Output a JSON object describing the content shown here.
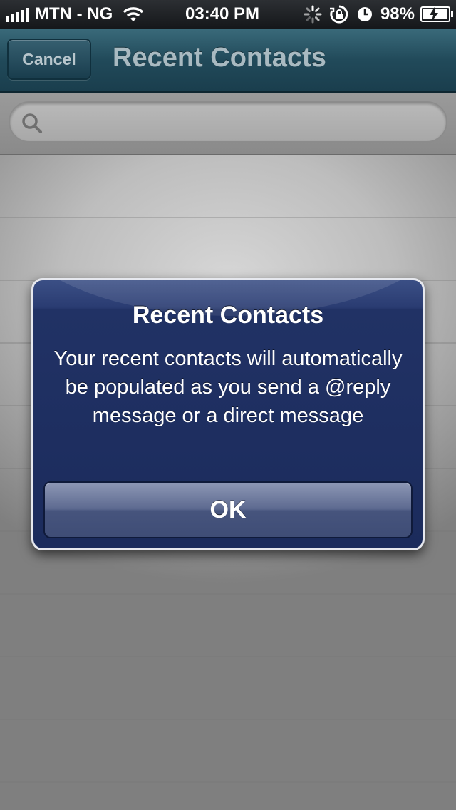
{
  "status_bar": {
    "carrier": "MTN - NG",
    "time": "03:40 PM",
    "battery_percent": "98%",
    "icons": [
      "signal-icon",
      "wifi-icon",
      "activity-spinner-icon",
      "rotation-lock-icon",
      "alarm-icon",
      "battery-charging-icon"
    ]
  },
  "nav": {
    "cancel_label": "Cancel",
    "title": "Recent Contacts",
    "accent_color": "#214a5a"
  },
  "search": {
    "placeholder": "",
    "icon": "search-icon"
  },
  "alert": {
    "title": "Recent Contacts",
    "message": "Your recent contacts will automatically be populated as you send a @reply message or a direct message",
    "button_label": "OK",
    "background_color": "#1b2b5c"
  }
}
